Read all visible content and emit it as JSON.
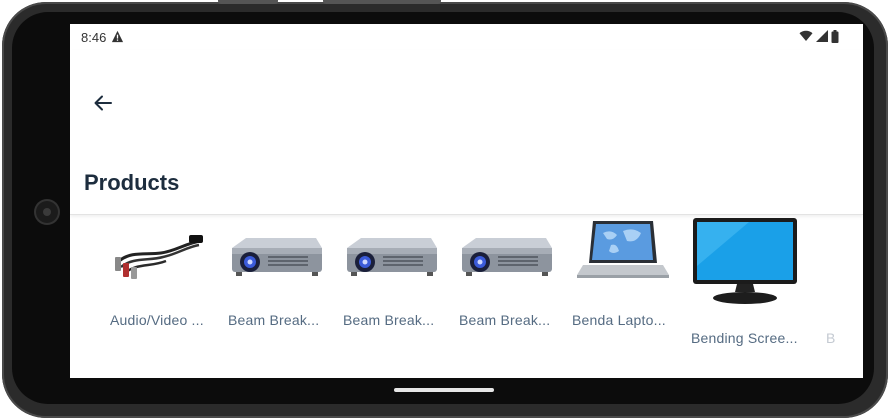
{
  "status_bar": {
    "time": "8:46"
  },
  "app_bar": {
    "title": "Products"
  },
  "products": [
    {
      "name": "Audio/Video ...",
      "image": "av-cable"
    },
    {
      "name": "Beam Break...",
      "image": "projector"
    },
    {
      "name": "Beam Break...",
      "image": "projector"
    },
    {
      "name": "Beam Break...",
      "image": "projector"
    },
    {
      "name": "Benda Lapto...",
      "image": "laptop"
    },
    {
      "name": "Bending Scree...",
      "image": "monitor"
    },
    {
      "name": "B",
      "image": ""
    }
  ],
  "colors": {
    "title": "#1d2d3e",
    "label": "#556b82",
    "frame": "#2b2b2b"
  }
}
